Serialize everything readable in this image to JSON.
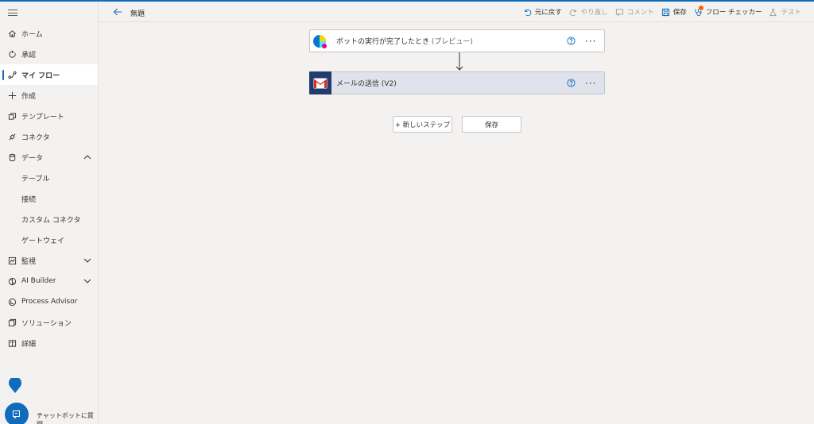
{
  "nav": {
    "items": [
      {
        "label": "ホーム",
        "icon": "home-icon"
      },
      {
        "label": "承認",
        "icon": "approval-icon"
      },
      {
        "label": "マイ フロー",
        "icon": "flow-icon"
      },
      {
        "label": "作成",
        "icon": "plus-icon"
      },
      {
        "label": "テンプレート",
        "icon": "template-icon"
      },
      {
        "label": "コネクタ",
        "icon": "connector-icon"
      },
      {
        "label": "データ",
        "icon": "database-icon"
      },
      {
        "label": "テーブル"
      },
      {
        "label": "接続"
      },
      {
        "label": "カスタム コネクタ"
      },
      {
        "label": "ゲートウェイ"
      },
      {
        "label": "監視",
        "icon": "monitor-icon"
      },
      {
        "label": "AI Builder",
        "icon": "ai-builder-icon"
      },
      {
        "label": "Process Advisor",
        "icon": "process-advisor-icon"
      },
      {
        "label": "ソリューション",
        "icon": "solution-icon"
      },
      {
        "label": "詳細",
        "icon": "book-icon"
      }
    ],
    "active": "マイ フロー"
  },
  "chatbot": {
    "label": "チャットボットに質問"
  },
  "header": {
    "title": "無題",
    "toolbar": {
      "undo": "元に戻す",
      "redo": "やり直し",
      "comment": "コメント",
      "save": "保存",
      "flow_checker": "フロー チェッカー",
      "test": "テスト"
    }
  },
  "flow": {
    "trigger": {
      "title": "ボットの実行が完了したとき",
      "suffix": "(プレビュー)"
    },
    "action": {
      "title": "メールの送信 (V2)"
    },
    "new_step": "+ 新しいステップ",
    "save": "保存"
  },
  "colors": {
    "accent": "#0f6cbd",
    "gmail_bg": "#233c6e",
    "action_bg": "#e1e3ec"
  }
}
